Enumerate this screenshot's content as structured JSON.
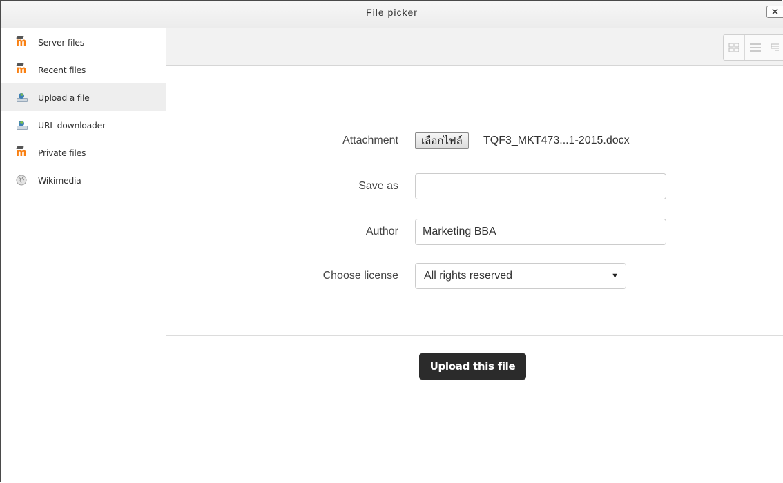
{
  "window": {
    "title": "File picker",
    "close_glyph": "✕"
  },
  "sidebar": {
    "items": [
      {
        "label": "Server files",
        "icon": "moodle-icon",
        "active": false
      },
      {
        "label": "Recent files",
        "icon": "moodle-icon",
        "active": false
      },
      {
        "label": "Upload a file",
        "icon": "upload-icon",
        "active": true
      },
      {
        "label": "URL downloader",
        "icon": "upload-icon",
        "active": false
      },
      {
        "label": "Private files",
        "icon": "moodle-icon",
        "active": false
      },
      {
        "label": "Wikimedia",
        "icon": "wikimedia-globe-icon",
        "active": false
      }
    ]
  },
  "toolbar": {
    "views": [
      "icons-view-icon",
      "list-view-icon",
      "tree-view-icon"
    ]
  },
  "form": {
    "attachment": {
      "label": "Attachment",
      "button_label": "เลือกไฟล์",
      "file_name": "TQF3_MKT473...1-2015.docx"
    },
    "save_as": {
      "label": "Save as",
      "value": ""
    },
    "author": {
      "label": "Author",
      "value": "Marketing BBA"
    },
    "license": {
      "label": "Choose license",
      "value": "All rights reserved"
    },
    "submit_label": "Upload this file"
  },
  "colors": {
    "accent": "#f98012",
    "button_dark": "#2b2b2b"
  }
}
